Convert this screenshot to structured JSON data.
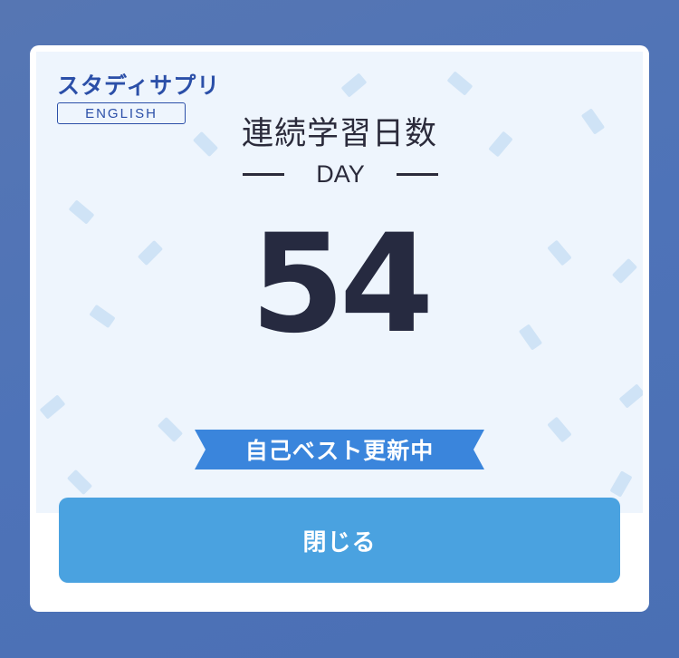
{
  "logo": {
    "text": "スタディサプリ",
    "sub": "ENGLISH"
  },
  "title": "連続学習日数",
  "day_label": "DAY",
  "streak_count": "54",
  "badge": "自己ベスト更新中",
  "close_button": "閉じる",
  "colors": {
    "background": "#4e73b8",
    "hero": "#eef5fd",
    "ribbon": "#3a85dc",
    "button": "#4aa2e0",
    "brand": "#2b4fa8",
    "confetti": "#cfe3f6"
  }
}
